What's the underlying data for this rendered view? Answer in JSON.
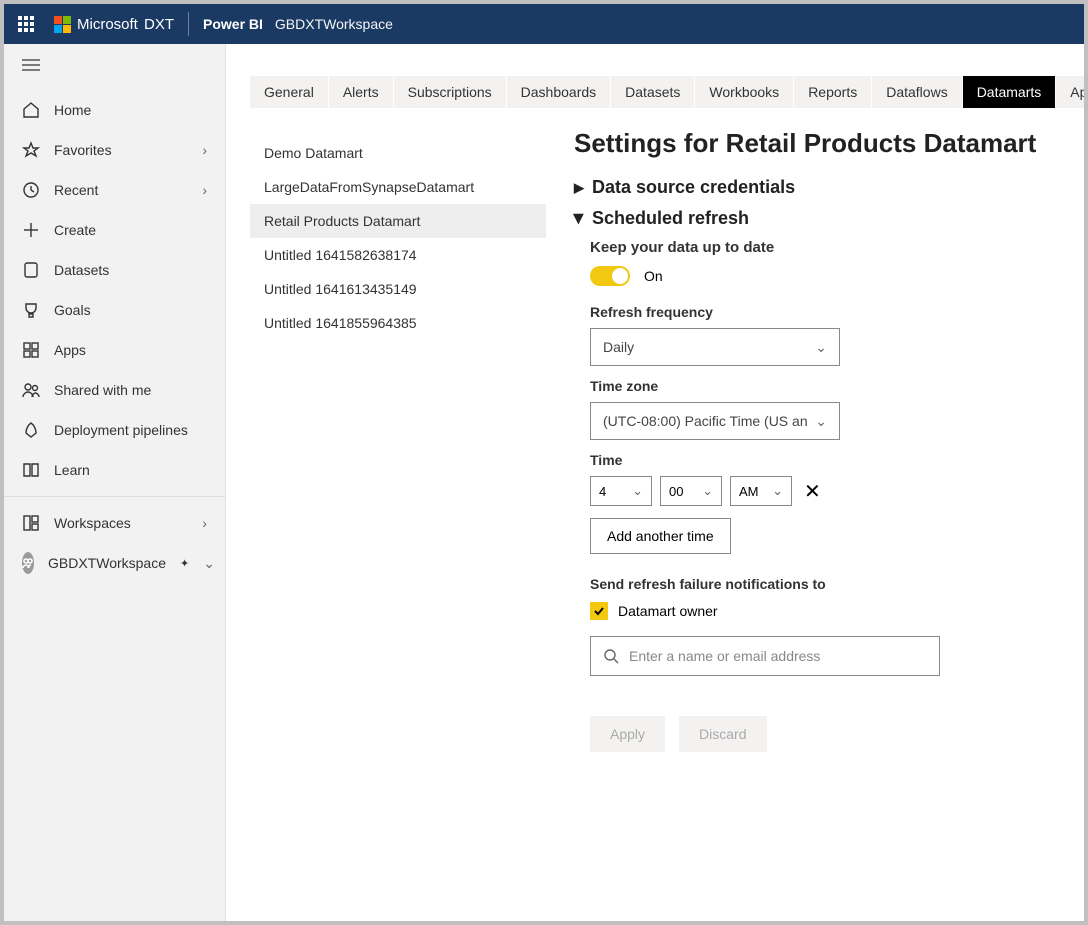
{
  "topbar": {
    "brand": "Microsoft",
    "brand_suffix": "DXT",
    "app": "Power BI",
    "workspace": "GBDXTWorkspace"
  },
  "sidebar": {
    "items": [
      {
        "label": "Home"
      },
      {
        "label": "Favorites",
        "expandable": true
      },
      {
        "label": "Recent",
        "expandable": true
      },
      {
        "label": "Create"
      },
      {
        "label": "Datasets"
      },
      {
        "label": "Goals"
      },
      {
        "label": "Apps"
      },
      {
        "label": "Shared with me"
      },
      {
        "label": "Deployment pipelines"
      },
      {
        "label": "Learn"
      }
    ],
    "workspaces_label": "Workspaces",
    "current_ws": "GBDXTWorkspace"
  },
  "tabs": [
    "General",
    "Alerts",
    "Subscriptions",
    "Dashboards",
    "Datasets",
    "Workbooks",
    "Reports",
    "Dataflows",
    "Datamarts",
    "App"
  ],
  "active_tab": "Datamarts",
  "datamart_list": [
    "Demo Datamart",
    "LargeDataFromSynapseDatamart",
    "Retail Products Datamart",
    "Untitled 1641582638174",
    "Untitled 1641613435149",
    "Untitled 1641855964385"
  ],
  "selected_datamart": "Retail Products Datamart",
  "settings": {
    "title": "Settings for Retail Products Datamart",
    "section_credentials": "Data source credentials",
    "section_refresh": "Scheduled refresh",
    "keep_uptodate_label": "Keep your data up to date",
    "toggle_state": "On",
    "freq_label": "Refresh frequency",
    "freq_value": "Daily",
    "tz_label": "Time zone",
    "tz_value": "(UTC-08:00) Pacific Time (US an",
    "time_label": "Time",
    "time_h": "4",
    "time_m": "00",
    "time_ampm": "AM",
    "add_time": "Add another time",
    "notify_label": "Send refresh failure notifications to",
    "notify_owner": "Datamart owner",
    "search_placeholder": "Enter a name or email address",
    "apply": "Apply",
    "discard": "Discard"
  }
}
